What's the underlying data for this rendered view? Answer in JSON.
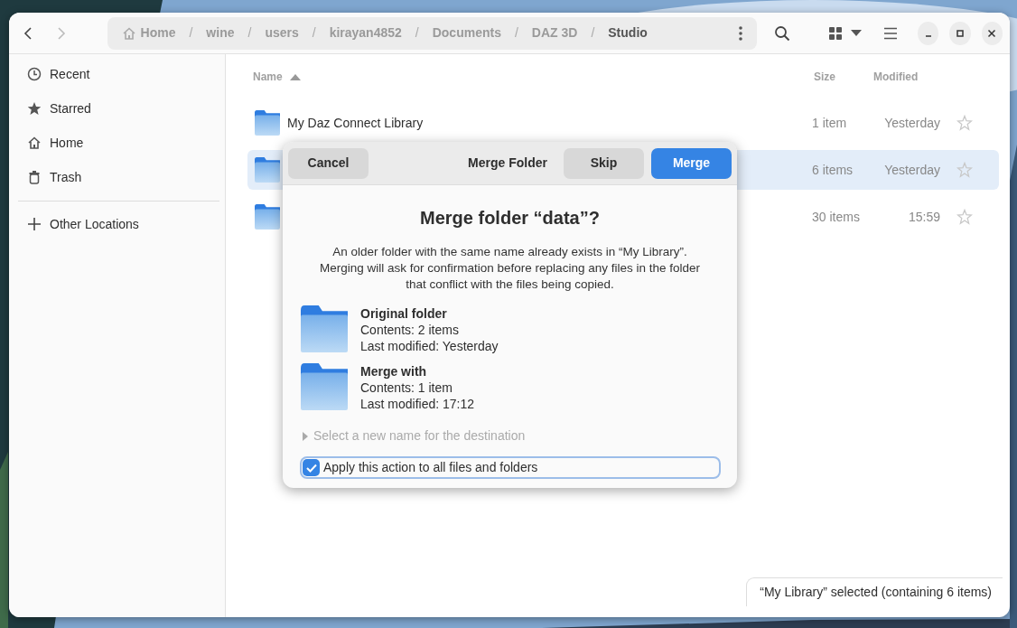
{
  "path_bar": {
    "crumbs": [
      {
        "label": "Home",
        "current": false
      },
      {
        "label": "wine",
        "current": false
      },
      {
        "label": "users",
        "current": false
      },
      {
        "label": "kirayan4852",
        "current": false
      },
      {
        "label": "Documents",
        "current": false
      },
      {
        "label": "DAZ 3D",
        "current": false
      },
      {
        "label": "Studio",
        "current": true
      }
    ],
    "separator": "/"
  },
  "sidebar": {
    "items": [
      {
        "label": "Recent",
        "kind": "recent"
      },
      {
        "label": "Starred",
        "kind": "starred"
      },
      {
        "label": "Home",
        "kind": "home"
      },
      {
        "label": "Trash",
        "kind": "trash"
      }
    ],
    "other": {
      "label": "Other Locations"
    }
  },
  "table": {
    "columns": [
      {
        "label": "Name",
        "sorted": true
      },
      {
        "label": "Size",
        "sorted": false
      },
      {
        "label": "Modified",
        "sorted": false
      }
    ],
    "rows": [
      {
        "name": "My Daz Connect Library",
        "size": "1 item",
        "modified": "Yesterday",
        "selected": false,
        "starred": false
      },
      {
        "size": "6 items",
        "modified": "Yesterday",
        "selected": true,
        "starred": false
      },
      {
        "size": "30 items",
        "modified": "15:59",
        "selected": false,
        "starred": false
      }
    ]
  },
  "dialog": {
    "title": "Merge Folder",
    "cancel": "Cancel",
    "skip": "Skip",
    "merge": "Merge",
    "heading": "Merge folder “data”?",
    "message": "An older folder with the same name already exists in “My Library”. Merging will ask for confirmation before replacing any files in the folder that conflict with the files being copied.",
    "folders": [
      {
        "title": "Original folder",
        "contents": "Contents: 2 items",
        "modified": "Last modified: Yesterday"
      },
      {
        "title": "Merge with",
        "contents": "Contents: 1 item",
        "modified": "Last modified: 17:12"
      }
    ],
    "rename_expander": {
      "label": "Select a new name for the destination",
      "expanded": false
    },
    "apply_all": {
      "label": "Apply this action to all files and folders",
      "checked": true
    }
  },
  "status_bar": {
    "text": "“My Library” selected  (containing 6 items)"
  }
}
